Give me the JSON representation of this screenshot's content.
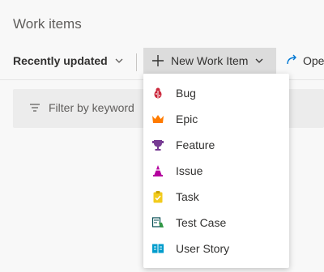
{
  "page": {
    "title": "Work items"
  },
  "toolbar": {
    "view_label": "Recently updated",
    "new_label": "New Work Item",
    "open_label": "Ope"
  },
  "filter": {
    "placeholder": "Filter by keyword"
  },
  "menu": {
    "items": [
      {
        "label": "Bug",
        "icon": "bug-icon",
        "color": "#cc293d"
      },
      {
        "label": "Epic",
        "icon": "crown-icon",
        "color": "#ff7b00"
      },
      {
        "label": "Feature",
        "icon": "trophy-icon",
        "color": "#773b93"
      },
      {
        "label": "Issue",
        "icon": "cone-icon",
        "color": "#b4009e"
      },
      {
        "label": "Task",
        "icon": "clipboard-icon",
        "color": "#f2cb1d"
      },
      {
        "label": "Test Case",
        "icon": "flask-icon",
        "color": "#004b50"
      },
      {
        "label": "User Story",
        "icon": "book-icon",
        "color": "#009ccc"
      }
    ]
  }
}
